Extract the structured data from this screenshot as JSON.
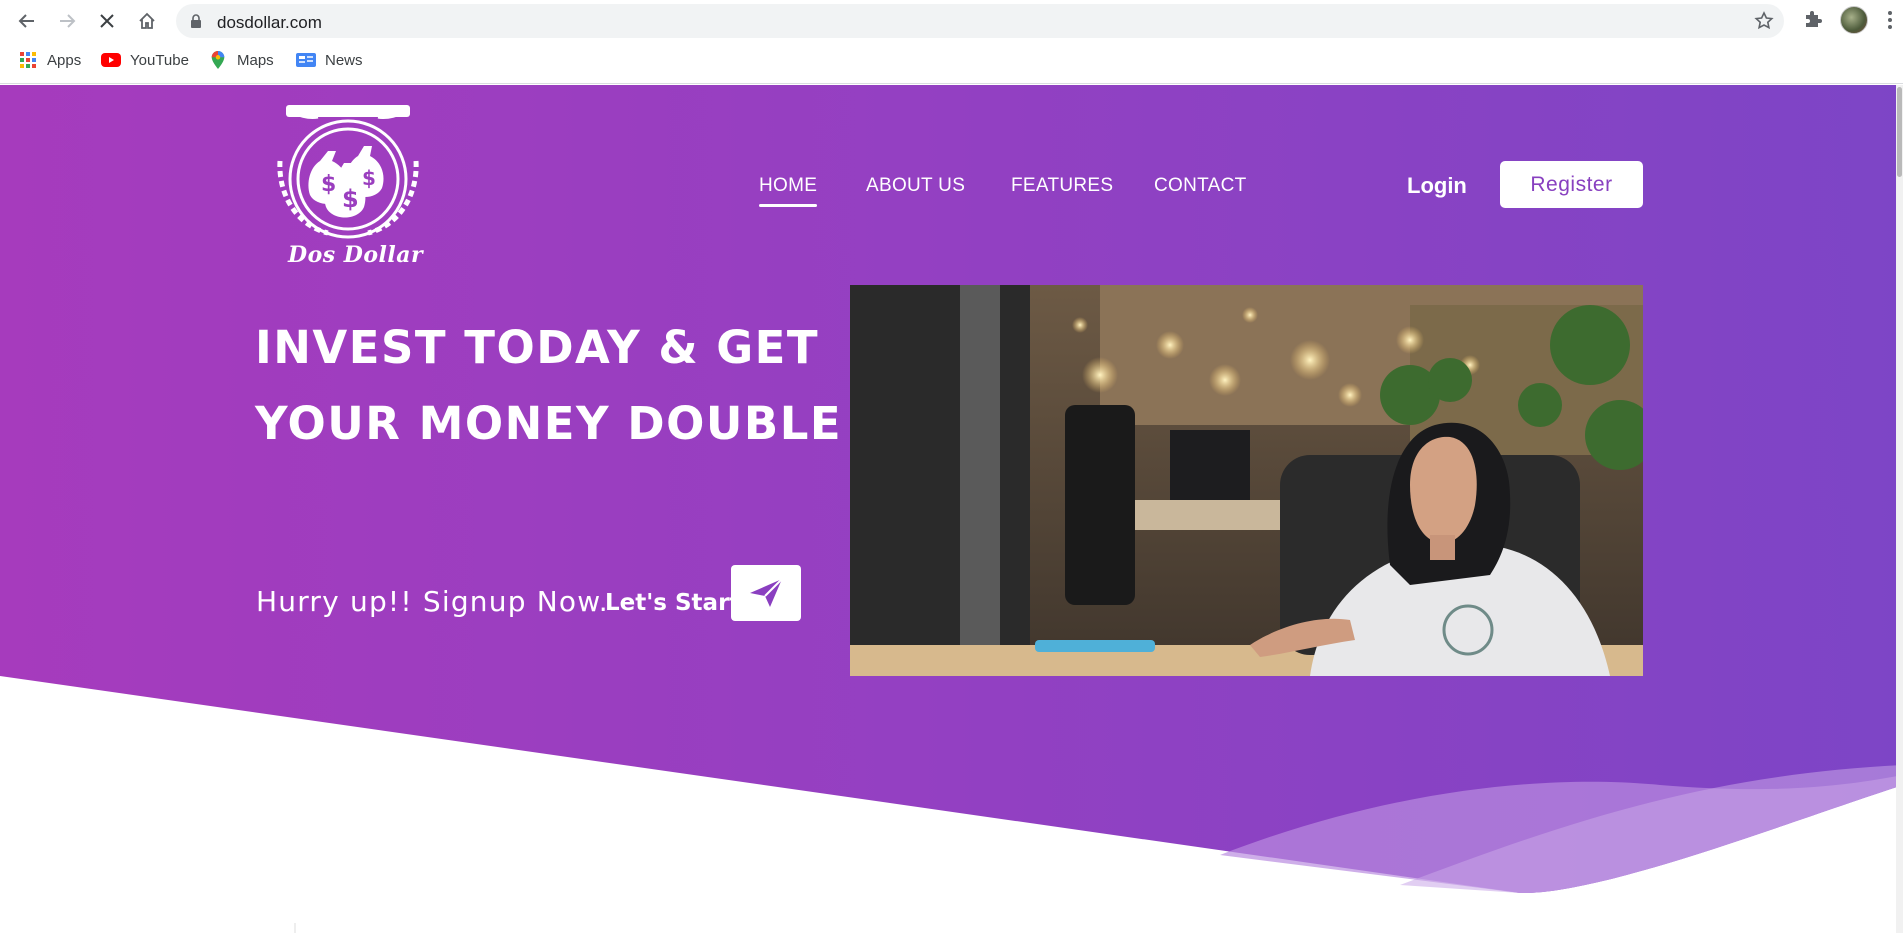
{
  "browser": {
    "url": "dosdollar.com",
    "bookmarks": [
      {
        "label": "Apps",
        "icon": "apps-grid-icon"
      },
      {
        "label": "YouTube",
        "icon": "youtube-icon"
      },
      {
        "label": "Maps",
        "icon": "maps-pin-icon"
      },
      {
        "label": "News",
        "icon": "google-news-icon"
      }
    ]
  },
  "site": {
    "brand": "Dos Dollar",
    "nav": [
      {
        "label": "HOME",
        "active": true
      },
      {
        "label": "ABOUT US",
        "active": false
      },
      {
        "label": "FEATURES",
        "active": false
      },
      {
        "label": "CONTACT",
        "active": false
      }
    ],
    "login_label": "Login",
    "register_label": "Register",
    "headline_line1": "INVEST TODAY & GET",
    "headline_line2": "YOUR MONEY DOUBLE",
    "tagline": "Hurry up!! Signup Now.",
    "cta_label": "Let's Start"
  },
  "colors": {
    "gradient_start": "#a63bbd",
    "gradient_end": "#7d45c6",
    "accent_text": "#8840c0"
  }
}
